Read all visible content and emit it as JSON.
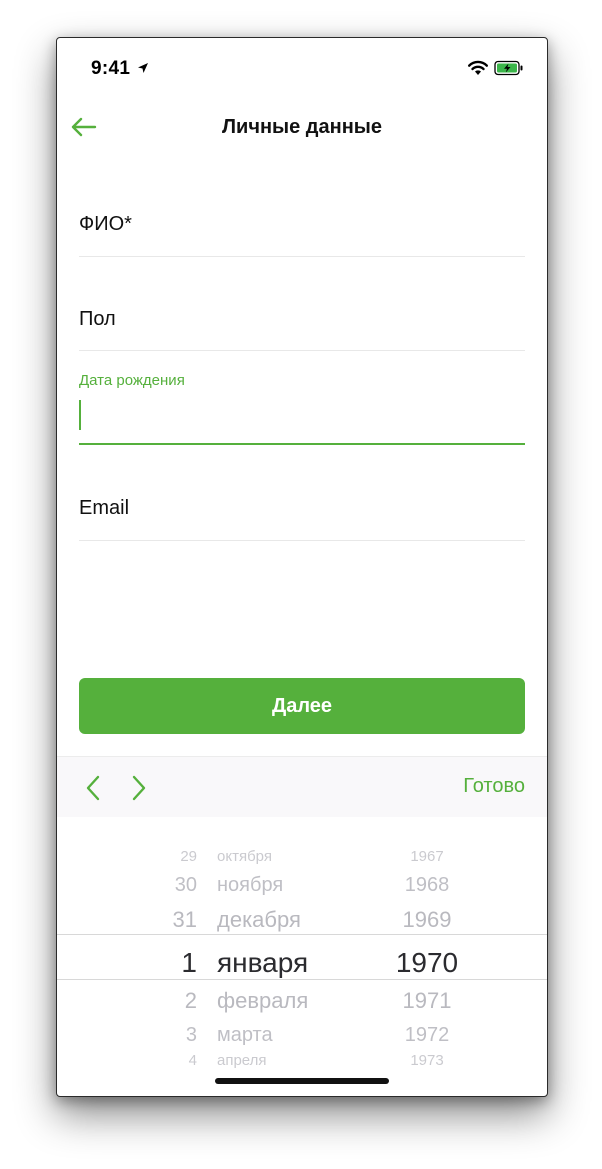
{
  "status_bar": {
    "time": "9:41"
  },
  "nav": {
    "title": "Личные данные"
  },
  "form": {
    "fio_label": "ФИО*",
    "gender_label": "Пол",
    "birthdate_label": "Дата рождения",
    "email_label": "Email",
    "next_button": "Далее"
  },
  "toolbar": {
    "done_label": "Готово"
  },
  "picker": {
    "days": [
      "29",
      "30",
      "31",
      "1",
      "2",
      "3",
      "4"
    ],
    "months": [
      "октября",
      "ноября",
      "декабря",
      "января",
      "февраля",
      "марта",
      "апреля"
    ],
    "years": [
      "1967",
      "1968",
      "1969",
      "1970",
      "1971",
      "1972",
      "1973"
    ],
    "selected": {
      "day": "1",
      "month": "января",
      "year": "1970"
    }
  },
  "colors": {
    "accent": "#55b03c"
  }
}
